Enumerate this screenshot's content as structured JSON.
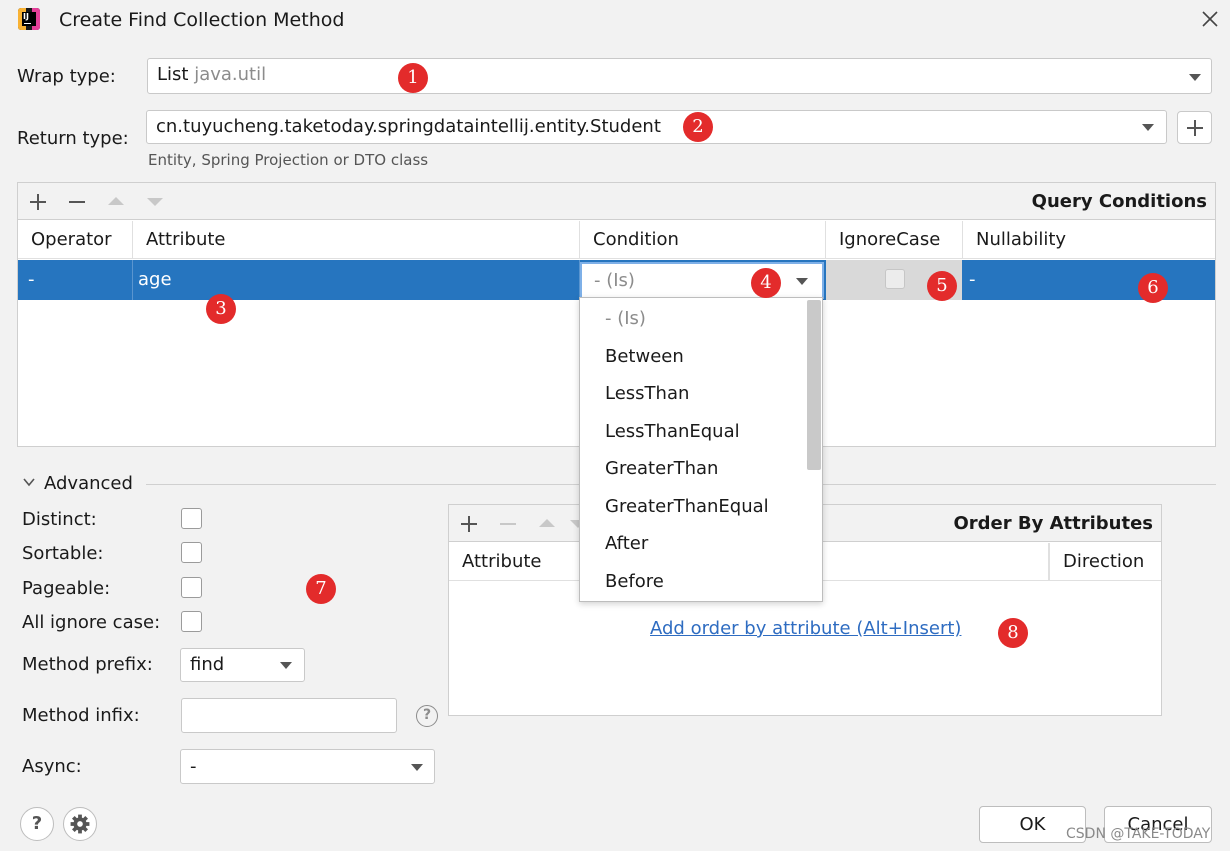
{
  "window": {
    "title": "Create Find Collection Method",
    "icon": "intellij-icon"
  },
  "wrap_type": {
    "label": "Wrap type:",
    "value_main": "List",
    "value_hint": "java.util"
  },
  "return_type": {
    "label": "Return type:",
    "value": "cn.tuyucheng.taketoday.springdataintellij.entity.Student",
    "hint": "Entity, Spring Projection or DTO class"
  },
  "query_conditions": {
    "title": "Query Conditions",
    "columns": [
      "Operator",
      "Attribute",
      "Condition",
      "IgnoreCase",
      "Nullability"
    ],
    "row": {
      "operator": "-",
      "attribute": "age",
      "condition": "- (Is)",
      "ignore_case": false,
      "nullability": "-"
    },
    "condition_options": [
      "- (Is)",
      "Between",
      "LessThan",
      "LessThanEqual",
      "GreaterThan",
      "GreaterThanEqual",
      "After",
      "Before"
    ]
  },
  "advanced": {
    "label": "Advanced",
    "distinct": "Distinct:",
    "sortable": "Sortable:",
    "pageable": "Pageable:",
    "all_ignore_case": "All ignore case:",
    "method_prefix_label": "Method prefix:",
    "method_prefix_value": "find",
    "method_infix_label": "Method infix:",
    "method_infix_value": "",
    "async_label": "Async:",
    "async_value": "-"
  },
  "order_by": {
    "title": "Order By Attributes",
    "columns": [
      "Attribute",
      "Direction"
    ],
    "empty_link": "Add order by attribute (Alt+Insert)"
  },
  "buttons": {
    "help": "?",
    "ok": "OK",
    "cancel": "Cancel"
  },
  "badges": [
    "1",
    "2",
    "3",
    "4",
    "5",
    "6",
    "7",
    "8"
  ],
  "watermark": "CSDN @TAKE-TODAY",
  "colors": {
    "selection": "#2675bf",
    "badge": "#e32b2b",
    "link": "#2e6cc1"
  }
}
